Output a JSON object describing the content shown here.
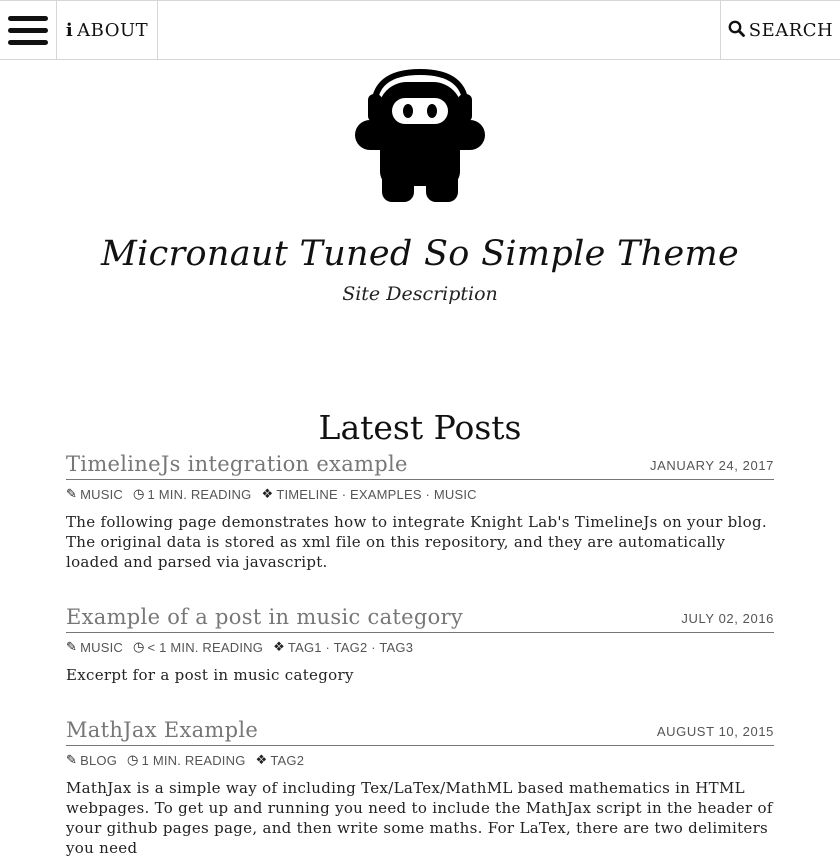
{
  "nav": {
    "about_label": "ABOUT",
    "search_label": "SEARCH"
  },
  "header": {
    "site_title": "Micronaut Tuned So Simple Theme",
    "site_description": "Site Description"
  },
  "main": {
    "section_title": "Latest Posts",
    "posts": [
      {
        "title": "TimelineJs integration example",
        "date": "JANUARY 24, 2017",
        "category": "MUSIC",
        "category_icon": "edit-icon",
        "reading_time": "1 MIN. READING",
        "tags": "TIMELINE · EXAMPLES · MUSIC",
        "excerpt": "The following page demonstrates how to integrate Knight Lab's TimelineJs on your blog. The original data is stored as xml file on this repository, and they are automatically loaded and parsed via javascript."
      },
      {
        "title": "Example of a post in music category",
        "date": "JULY 02, 2016",
        "category": "MUSIC",
        "category_icon": "edit-icon",
        "reading_time": "< 1 MIN. READING",
        "tags": "TAG1 · TAG2 · TAG3",
        "excerpt": "Excerpt for a post in music category"
      },
      {
        "title": "MathJax Example",
        "date": "AUGUST 10, 2015",
        "category": "BLOG",
        "category_icon": "edit-icon",
        "reading_time": "1 MIN. READING",
        "tags": "TAG2",
        "excerpt": "MathJax is a simple way of including Tex/LaTex/MathML based mathematics in HTML webpages. To get up and running you need to include the MathJax script in the header of your github pages page, and then write some maths. For LaTex, there are two delimiters you need"
      }
    ]
  }
}
